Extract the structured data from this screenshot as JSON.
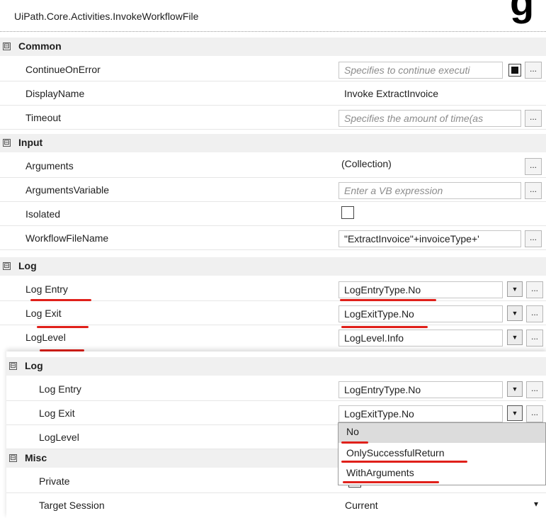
{
  "header": {
    "title": "UiPath.Core.Activities.InvokeWorkflowFile",
    "corner_glyph": "g"
  },
  "sections": {
    "common": {
      "name": "Common",
      "toggle": "⊟"
    },
    "input": {
      "name": "Input",
      "toggle": "⊟"
    },
    "log": {
      "name": "Log",
      "toggle": "⊟"
    },
    "log2": {
      "name": "Log",
      "toggle": "⊟"
    },
    "misc": {
      "name": "Misc",
      "toggle": "⊟"
    }
  },
  "rows": {
    "continue_on_error": {
      "label": "ContinueOnError",
      "placeholder": "Specifies to continue executi"
    },
    "display_name": {
      "label": "DisplayName",
      "value": "Invoke ExtractInvoice"
    },
    "timeout": {
      "label": "Timeout",
      "placeholder": "Specifies the amount of time(as"
    },
    "arguments": {
      "label": "Arguments",
      "value": "(Collection)"
    },
    "arguments_variable": {
      "label": "ArgumentsVariable",
      "placeholder": "Enter a VB expression"
    },
    "isolated": {
      "label": "Isolated"
    },
    "workflow_file_name": {
      "label": "WorkflowFileName",
      "value": "\"ExtractInvoice\"+invoiceType+'"
    },
    "log_entry": {
      "label": "Log Entry",
      "value": "LogEntryType.No"
    },
    "log_exit": {
      "label": "Log Exit",
      "value": "LogExitType.No"
    },
    "log_level": {
      "label": "LogLevel",
      "value": "LogLevel.Info"
    },
    "log2_entry": {
      "label": "Log Entry",
      "value": "LogEntryType.No"
    },
    "log2_exit": {
      "label": "Log Exit",
      "value": "LogExitType.No"
    },
    "log2_level": {
      "label": "LogLevel"
    },
    "private": {
      "label": "Private"
    },
    "target_session": {
      "label": "Target Session",
      "value": "Current"
    }
  },
  "buttons": {
    "ellipsis": "...",
    "dropdown": "▼",
    "dropdown_small": "▾"
  },
  "dropdown_options": [
    "No",
    "OnlySuccessfulReturn",
    "WithArguments"
  ],
  "colors": {
    "annotation_red": "#e0201a",
    "section_bg": "#f0f0f0",
    "selected_option": "#dcdcdc"
  }
}
